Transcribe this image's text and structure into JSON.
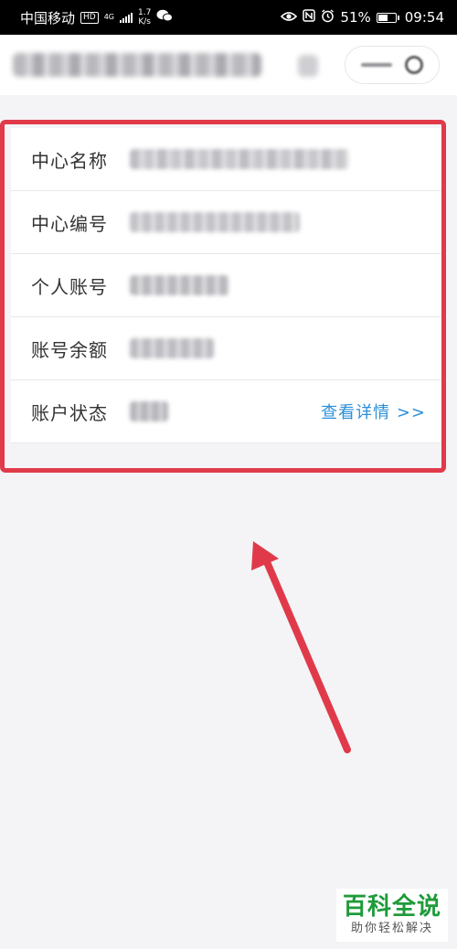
{
  "status_bar": {
    "carrier": "中国移动",
    "hd": "HD",
    "network": "4G",
    "speed_value": "1.7",
    "speed_unit": "K/s",
    "battery_percent": "51%",
    "time": "09:54"
  },
  "account_info": {
    "rows": [
      {
        "label": "中心名称"
      },
      {
        "label": "中心编号"
      },
      {
        "label": "个人账号"
      },
      {
        "label": "账号余额"
      },
      {
        "label": "账户状态"
      }
    ],
    "detail_link": "查看详情 >>"
  },
  "watermark": {
    "main": "百科全说",
    "sub": "助你轻松解决"
  },
  "colors": {
    "annotation": "#e03a4a",
    "link": "#2a8fd8",
    "watermark_green": "#1f9b3a"
  }
}
